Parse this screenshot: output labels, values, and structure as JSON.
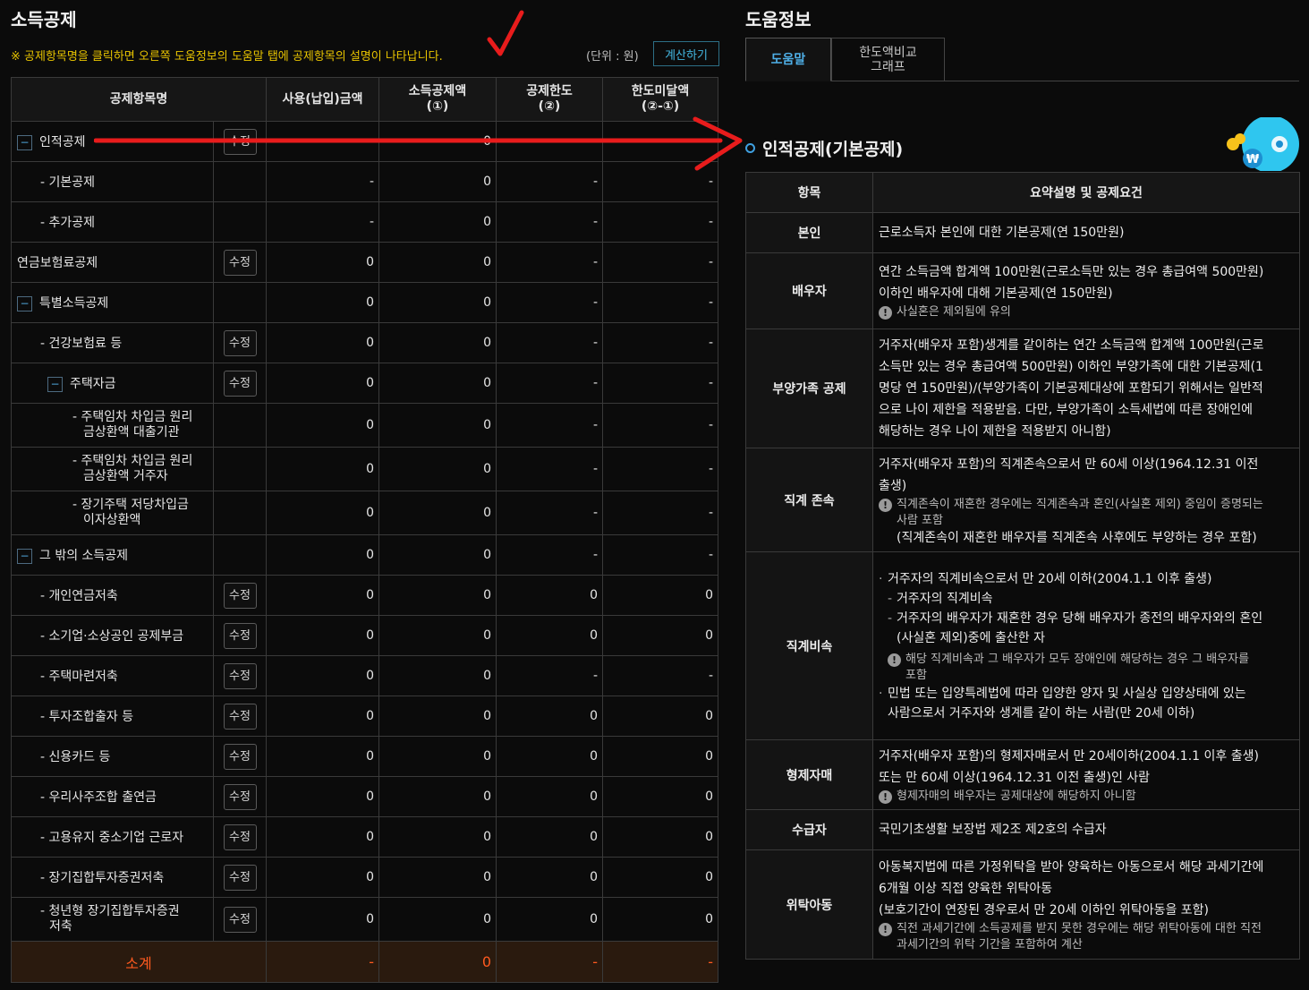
{
  "left": {
    "title": "소득공제",
    "notice": "※ 공제항목명을 클릭하면 오른쪽 도움정보의 도움말 탭에 공제항목의 설명이 나타납니다.",
    "unit": "(단위 : 원)",
    "calc_button": "계산하기",
    "headers": {
      "name": "공제항목명",
      "paid": "사용(납입)금액",
      "amount": "소득공제액",
      "amount_sub": "(①)",
      "limit": "공제한도",
      "limit_sub": "(②)",
      "shortfall": "한도미달액",
      "shortfall_sub": "(②-①)"
    },
    "edit_label": "수정",
    "toggle_symbol": "−",
    "rows": [
      {
        "name": "인적공제",
        "paid": "",
        "amount": "0",
        "limit": "",
        "short": ""
      },
      {
        "name": "- 기본공제",
        "paid": "-",
        "amount": "0",
        "limit": "-",
        "short": "-"
      },
      {
        "name": "- 추가공제",
        "paid": "-",
        "amount": "0",
        "limit": "-",
        "short": "-"
      },
      {
        "name": "연금보험료공제",
        "paid": "0",
        "amount": "0",
        "limit": "-",
        "short": "-"
      },
      {
        "name": "특별소득공제",
        "paid": "0",
        "amount": "0",
        "limit": "-",
        "short": "-"
      },
      {
        "name": "- 건강보험료 등",
        "paid": "0",
        "amount": "0",
        "limit": "-",
        "short": "-"
      },
      {
        "name": "주택자금",
        "paid": "0",
        "amount": "0",
        "limit": "-",
        "short": "-"
      },
      {
        "name1": "- 주택임차 차입금 원리",
        "name2": "금상환액 대출기관",
        "paid": "0",
        "amount": "0",
        "limit": "-",
        "short": "-"
      },
      {
        "name1": "- 주택임차 차입금 원리",
        "name2": "금상환액 거주자",
        "paid": "0",
        "amount": "0",
        "limit": "-",
        "short": "-"
      },
      {
        "name1": "- 장기주택 저당차입금",
        "name2": "이자상환액",
        "paid": "0",
        "amount": "0",
        "limit": "-",
        "short": "-"
      },
      {
        "name": "그 밖의 소득공제",
        "paid": "0",
        "amount": "0",
        "limit": "-",
        "short": "-"
      },
      {
        "name": "- 개인연금저축",
        "paid": "0",
        "amount": "0",
        "limit": "0",
        "short": "0"
      },
      {
        "name": "- 소기업·소상공인 공제부금",
        "paid": "0",
        "amount": "0",
        "limit": "0",
        "short": "0"
      },
      {
        "name": "- 주택마련저축",
        "paid": "0",
        "amount": "0",
        "limit": "-",
        "short": "-"
      },
      {
        "name": "- 투자조합출자 등",
        "paid": "0",
        "amount": "0",
        "limit": "0",
        "short": "0"
      },
      {
        "name": "- 신용카드 등",
        "paid": "0",
        "amount": "0",
        "limit": "0",
        "short": "0"
      },
      {
        "name": "- 우리사주조합 출연금",
        "paid": "0",
        "amount": "0",
        "limit": "0",
        "short": "0"
      },
      {
        "name": "- 고용유지 중소기업 근로자",
        "paid": "0",
        "amount": "0",
        "limit": "0",
        "short": "0"
      },
      {
        "name": "- 장기집합투자증권저축",
        "paid": "0",
        "amount": "0",
        "limit": "0",
        "short": "0"
      },
      {
        "name1": "- 청년형 장기집합투자증권",
        "name2": "저축",
        "paid": "0",
        "amount": "0",
        "limit": "0",
        "short": "0"
      }
    ],
    "subtotal": {
      "label": "소계",
      "paid": "-",
      "amount": "0",
      "limit": "-",
      "short": "-"
    }
  },
  "help": {
    "title": "도움정보",
    "tab_active": "도움말",
    "tab_inactive_1": "한도액비교",
    "tab_inactive_2": "그래프",
    "section_title": "인적공제(기본공제)",
    "mascot_symbol": "₩",
    "col_item": "항목",
    "col_desc": "요약설명 및 공제요건",
    "note_symbol": "!",
    "rows": {
      "self": {
        "k": "본인",
        "v": "근로소득자 본인에 대한 기본공제(연 150만원)"
      },
      "spouse": {
        "k": "배우자",
        "v1": "연간 소득금액 합계액 100만원(근로소득만 있는 경우 총급여액 500만원)",
        "v2": "이하인 배우자에 대해 기본공제(연 150만원)",
        "note": "사실혼은 제외됨에 유의"
      },
      "dependents": {
        "k": "부양가족 공제",
        "l1": "거주자(배우자 포함)생계를 같이하는 연간 소득금액 합계액 100만원(근로",
        "l2": "소득만 있는 경우 총급여액 500만원) 이하인 부양가족에 대한 기본공제(1",
        "l3": "명당 연 150만원)/(부양가족이 기본공제대상에 포함되기 위해서는 일반적",
        "l4": "으로 나이 제한을 적용받음. 다만, 부양가족이 소득세법에 따른 장애인에",
        "l5": "해당하는 경우 나이 제한을 적용받지 아니함)"
      },
      "ascendant": {
        "k": "직계 존속",
        "l1": "거주자(배우자 포함)의 직계존속으로서 만 60세 이상(1964.12.31 이전",
        "l2": "출생)",
        "n1": "직계존속이 재혼한 경우에는 직계존속과 혼인(사실혼 제외) 중임이 증명되는",
        "n2": "사람 포함",
        "n3": "(직계존속이 재혼한 배우자를 직계존속 사후에도 부양하는 경우 포함)"
      },
      "descendant": {
        "k": "직계비속",
        "bullet_mark": "·",
        "dash_mark": "-",
        "b1": "거주자의 직계비속으로서 만 20세 이하(2004.1.1 이후 출생)",
        "d1": "거주자의 직계비속",
        "d2a": "거주자의 배우자가 재혼한 경우 당해 배우자가 종전의 배우자와의 혼인",
        "d2b": "(사실혼 제외)중에 출산한 자",
        "n1": "해당 직계비속과 그 배우자가 모두 장애인에 해당하는 경우 그 배우자를",
        "n2": "포함",
        "b2a": "민법 또는 입양특례법에 따라 입양한 양자 및 사실상 입양상태에 있는",
        "b2b": "사람으로서 거주자와 생계를 같이 하는 사람(만 20세 이하)"
      },
      "siblings": {
        "k": "형제자매",
        "l1": "거주자(배우자 포함)의 형제자매로서 만 20세이하(2004.1.1 이후 출생)",
        "l2": "또는 만 60세 이상(1964.12.31 이전 출생)인 사람",
        "note": "형제자매의 배우자는 공제대상에 해당하지 아니함"
      },
      "recipient": {
        "k": "수급자",
        "v": "국민기초생활 보장법 제2조 제2호의 수급자"
      },
      "foster": {
        "k": "위탁아동",
        "l1": "아동복지법에 따른 가정위탁을 받아 양육하는 아동으로서 해당 과세기간에",
        "l2": "6개월 이상 직접 양육한 위탁아동",
        "l3": "(보호기간이 연장된 경우로서 만 20세 이하인 위탁아동을 포함)",
        "n1": "직전 과세기간에 소득공제를 받지 못한 경우에는 해당 위탁아동에 대한 직전",
        "n2": "과세기간의 위탁 기간을 포함하여 계산"
      }
    }
  },
  "colors": {
    "accent": "#4fb0e8",
    "notice": "#e8c400",
    "subtotal": "#ff5a1f",
    "annotation": "#e81c1c"
  }
}
